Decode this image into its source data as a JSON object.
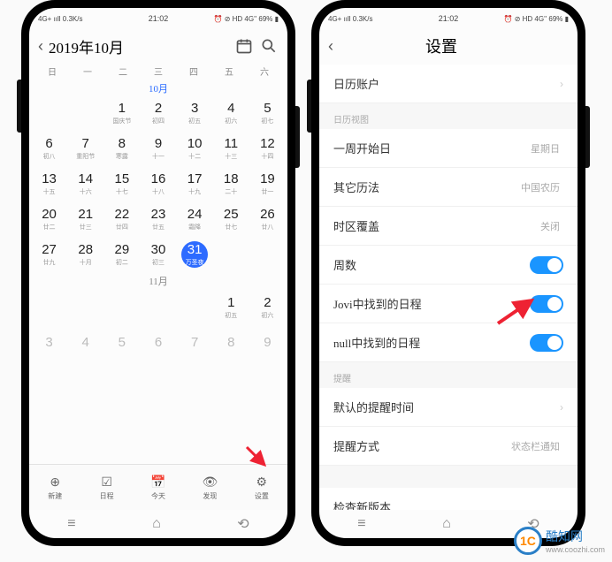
{
  "status": {
    "left": "4G+ ııll 0.3K/s",
    "center": "21:02",
    "right": "⏰ ⊘ HD 4G'' 69% ▮"
  },
  "calendar": {
    "title": "2019年10月",
    "weekdays": [
      "日",
      "一",
      "二",
      "三",
      "四",
      "五",
      "六"
    ],
    "month_label": "10月",
    "next_month_label": "11月",
    "tabs": {
      "new": {
        "icon": "⊕",
        "label": "新建"
      },
      "schedule": {
        "icon": "☑",
        "label": "日程"
      },
      "today": {
        "icon": "📅",
        "label": "今天"
      },
      "discover": {
        "icon": "👁",
        "label": "发现"
      },
      "settings": {
        "icon": "⚙",
        "label": "设置"
      }
    },
    "days": [
      {
        "n": "",
        "sub": ""
      },
      {
        "n": "",
        "sub": ""
      },
      {
        "n": "1",
        "sub": "国庆节"
      },
      {
        "n": "2",
        "sub": "初四"
      },
      {
        "n": "3",
        "sub": "初五"
      },
      {
        "n": "4",
        "sub": "初六"
      },
      {
        "n": "5",
        "sub": "初七"
      },
      {
        "n": "6",
        "sub": "初八"
      },
      {
        "n": "7",
        "sub": "重阳节"
      },
      {
        "n": "8",
        "sub": "寒露"
      },
      {
        "n": "9",
        "sub": "十一"
      },
      {
        "n": "10",
        "sub": "十二"
      },
      {
        "n": "11",
        "sub": "十三"
      },
      {
        "n": "12",
        "sub": "十四"
      },
      {
        "n": "13",
        "sub": "十五"
      },
      {
        "n": "14",
        "sub": "十六"
      },
      {
        "n": "15",
        "sub": "十七"
      },
      {
        "n": "16",
        "sub": "十八"
      },
      {
        "n": "17",
        "sub": "十九"
      },
      {
        "n": "18",
        "sub": "二十"
      },
      {
        "n": "19",
        "sub": "廿一"
      },
      {
        "n": "20",
        "sub": "廿二"
      },
      {
        "n": "21",
        "sub": "廿三"
      },
      {
        "n": "22",
        "sub": "廿四"
      },
      {
        "n": "23",
        "sub": "廿五"
      },
      {
        "n": "24",
        "sub": "霜降"
      },
      {
        "n": "25",
        "sub": "廿七"
      },
      {
        "n": "26",
        "sub": "廿八"
      },
      {
        "n": "27",
        "sub": "廿九"
      },
      {
        "n": "28",
        "sub": "十月"
      },
      {
        "n": "29",
        "sub": "初二"
      },
      {
        "n": "30",
        "sub": "初三"
      },
      {
        "n": "31",
        "sub": "万圣夜",
        "today": true
      },
      {
        "n": "",
        "sub": ""
      },
      {
        "n": "",
        "sub": ""
      }
    ],
    "next_days": [
      {
        "n": "",
        "sub": ""
      },
      {
        "n": "",
        "sub": ""
      },
      {
        "n": "",
        "sub": ""
      },
      {
        "n": "",
        "sub": ""
      },
      {
        "n": "",
        "sub": ""
      },
      {
        "n": "1",
        "sub": "初五"
      },
      {
        "n": "2",
        "sub": "初六"
      },
      {
        "n": "3",
        "sub": ""
      },
      {
        "n": "4",
        "sub": ""
      },
      {
        "n": "5",
        "sub": ""
      },
      {
        "n": "6",
        "sub": ""
      },
      {
        "n": "7",
        "sub": ""
      },
      {
        "n": "8",
        "sub": ""
      },
      {
        "n": "9",
        "sub": ""
      }
    ]
  },
  "settings": {
    "title": "设置",
    "sections": {
      "accounts_row": "日历账户",
      "view_group": "日历视图",
      "week_start": {
        "label": "一周开始日",
        "value": "星期日"
      },
      "alt_cal": {
        "label": "其它历法",
        "value": "中国农历"
      },
      "tz_override": {
        "label": "时区覆盖",
        "value": "关闭"
      },
      "week_num": {
        "label": "周数",
        "on": true
      },
      "jovi": {
        "label": "Jovi中找到的日程",
        "on": true
      },
      "null_row": {
        "label": "null中找到的日程",
        "on": true
      },
      "reminder_group": "提醒",
      "default_remind": {
        "label": "默认的提醒时间"
      },
      "remind_mode": {
        "label": "提醒方式",
        "value": "状态栏通知"
      },
      "check_update": "检查新版本"
    }
  },
  "watermark": {
    "brand": "酷知网",
    "url": "www.coozhi.com",
    "logo": "1C"
  }
}
